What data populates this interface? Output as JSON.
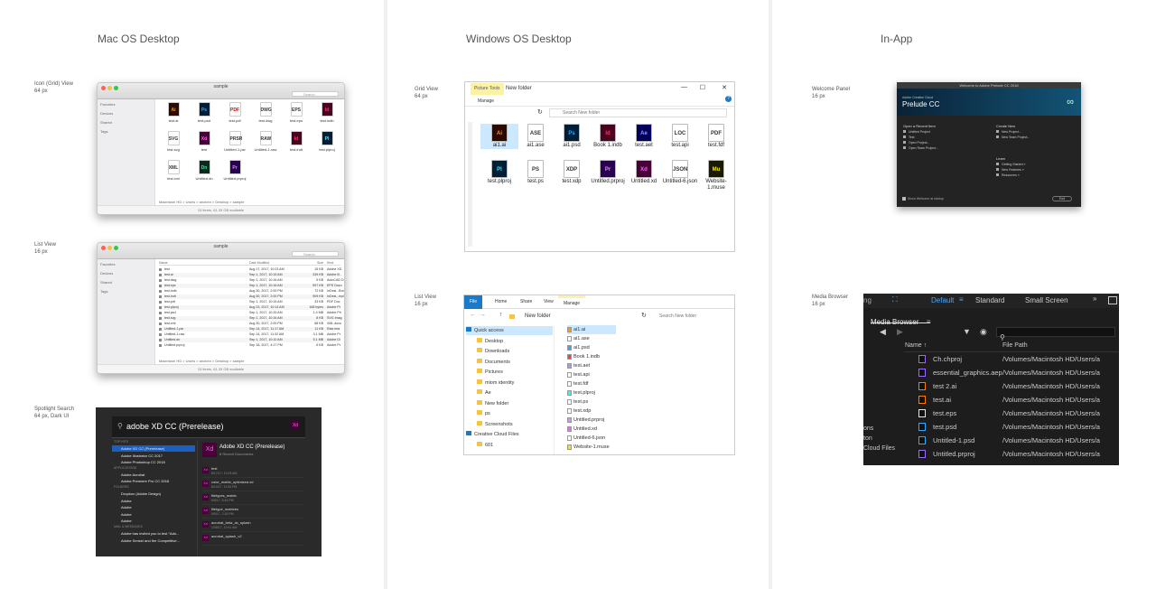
{
  "columns": {
    "mac": "Mac OS Desktop",
    "windows": "Windows OS Desktop",
    "inapp": "In-App"
  },
  "sections": {
    "mac_grid": [
      "Icon (Grid) View",
      "64 px"
    ],
    "mac_list": [
      "List View",
      "16 px"
    ],
    "mac_spot": [
      "Spotlight Search",
      "64 px, Dark UI"
    ],
    "win_grid": [
      "Grid View",
      "64 px"
    ],
    "win_list": [
      "List View",
      "16 px"
    ],
    "app_welcome": [
      "Welcome Panel",
      "16 px"
    ],
    "app_media": [
      "Media Browser",
      "16 px"
    ]
  },
  "mac_grid": {
    "title": "sample",
    "search": "Search",
    "sidebar": [
      "Favorites",
      "Devices",
      "Shared",
      "Tags"
    ],
    "path": "Macintosh HD > Users > anchen > Desktop > sample",
    "status": "15 items, 61.33 GB available",
    "files": [
      {
        "label": "test.ai",
        "glyph": "Ai",
        "color": "#2b0a00",
        "fg": "#ff9a00"
      },
      {
        "label": "test.psd",
        "glyph": "Ps",
        "color": "#001e36",
        "fg": "#31a8ff"
      },
      {
        "label": "test.pdf",
        "glyph": "PDF",
        "color": "#fff",
        "fg": "#d00"
      },
      {
        "label": "test.dwg",
        "glyph": "DWG",
        "color": "#fff",
        "fg": "#333"
      },
      {
        "label": "test.eps",
        "glyph": "EPS",
        "color": "#fff",
        "fg": "#333"
      },
      {
        "label": "test.indb",
        "glyph": "Id",
        "color": "#49021f",
        "fg": "#ff3366"
      },
      {
        "label": "test.svg",
        "glyph": "SVG",
        "color": "#fff",
        "fg": "#333"
      },
      {
        "label": "test",
        "glyph": "Xd",
        "color": "#470137",
        "fg": "#ff61f6"
      },
      {
        "label": "Untitled-1.psr",
        "glyph": "PRSR",
        "color": "#fff",
        "fg": "#333"
      },
      {
        "label": "Untitled-1.raw",
        "glyph": "RAW",
        "color": "#fff",
        "fg": "#333"
      },
      {
        "label": "test.indt",
        "glyph": "Id",
        "color": "#49021f",
        "fg": "#ff3366"
      },
      {
        "label": "test.plproj",
        "glyph": "Pl",
        "color": "#001e36",
        "fg": "#31f0ff"
      },
      {
        "label": "test.xml",
        "glyph": "XML",
        "color": "#fff",
        "fg": "#333"
      },
      {
        "label": "Untitled.dn",
        "glyph": "Dn",
        "color": "#0a2a1c",
        "fg": "#30e5b0"
      },
      {
        "label": "Untitled.prproj",
        "glyph": "Pr",
        "color": "#2a0050",
        "fg": "#d291ff"
      }
    ]
  },
  "mac_list": {
    "title": "sample",
    "search": "Search",
    "sidebar": [
      "Favorites",
      "Devices",
      "Shared",
      "Tags"
    ],
    "headers": [
      "Name",
      "Date Modified",
      "Size",
      "Kind"
    ],
    "rows": [
      [
        "test",
        "Aug 17, 2017, 10:23 AM",
        "15 KB",
        "Adobe XD"
      ],
      [
        "test.ai",
        "Sep 1, 2017, 10:15 AM",
        "339 KB",
        "Adobe Ill..."
      ],
      [
        "test.dwg",
        "Sep 1, 2017, 10:16 AM",
        "5 KB",
        "AutoCAD D"
      ],
      [
        "test.eps",
        "Sep 1, 2017, 10:16 AM",
        "597 KB",
        "EPS Docu"
      ],
      [
        "test.indb",
        "Aug 30, 2017, 2:00 PM",
        "72 KB",
        "InDesi...Book"
      ],
      [
        "test.indt",
        "Aug 30, 2017, 2:00 PM",
        "909 KB",
        "InDesi...mplate"
      ],
      [
        "test.pdf",
        "Sep 1, 2017, 10:15 AM",
        "33 KB",
        "PDF Doc"
      ],
      [
        "test.plproj",
        "Aug 23, 2017, 10:14 AM",
        "168 bytes",
        "Adobe Pr"
      ],
      [
        "test.psd",
        "Sep 1, 2017, 10:15 AM",
        "1.4 MB",
        "Adobe Ph"
      ],
      [
        "test.svg",
        "Sep 1, 2017, 10:16 AM",
        "8 KB",
        "SVG Imag"
      ],
      [
        "test.xml",
        "Aug 30, 2017, 2:00 PM",
        "68 KB",
        "XML docu"
      ],
      [
        "Untitled-1.psr",
        "Sep 14, 2017, 11:17 AM",
        "11 KB",
        "Raw ima"
      ],
      [
        "Untitled-1.raw",
        "Sep 14, 2017, 11:32 AM",
        "3.1 MB",
        "Adobe Pr"
      ],
      [
        "Untitled.dn",
        "Sep 1, 2017, 10:10 AM",
        "5.1 MB",
        "Adobe Di"
      ],
      [
        "Untitled.prproj",
        "Sep 18, 2017, 4:17 PM",
        "6 KB",
        "Adobe Pr"
      ]
    ],
    "path": "Macintosh HD > Users > anchen > Desktop > sample",
    "status": "15 items, 61.33 GB available"
  },
  "spotlight": {
    "query": "adobe XD CC (Prerelease)",
    "hero_title": "Adobe XD CC (Prerelease)",
    "hero_sub": "8 Recent Documents",
    "left": [
      {
        "type": "h",
        "t": "TOP HITS"
      },
      {
        "type": "sel",
        "t": "Adobe XD CC (Prerelease)"
      },
      {
        "type": "i",
        "t": "Adobe Illustrator CC 2017"
      },
      {
        "type": "i",
        "t": "Adobe Photoshop CC 2018"
      },
      {
        "type": "h",
        "t": "APPLICATIONS"
      },
      {
        "type": "i",
        "t": "Adobe Acrobat"
      },
      {
        "type": "i",
        "t": "Adobe Premiere Pro CC 2018"
      },
      {
        "type": "h",
        "t": "FOLDERS"
      },
      {
        "type": "i",
        "t": "Dropbox (Adobe Design)"
      },
      {
        "type": "i",
        "t": "Adobe"
      },
      {
        "type": "i",
        "t": "Adobe"
      },
      {
        "type": "i",
        "t": "Adobe"
      },
      {
        "type": "i",
        "t": "Adobe"
      },
      {
        "type": "h",
        "t": "MAIL & MESSAGES"
      },
      {
        "type": "i",
        "t": "Adobe has invited you to test \"Ado..."
      },
      {
        "type": "i",
        "t": "Adobe Sensei and the Competitive..."
      }
    ],
    "docs": [
      {
        "name": "test",
        "date": "8/17/17, 10:23 AM"
      },
      {
        "name": "color_matrix_optimized.xd",
        "date": "8/10/17, 11:54 PM"
      },
      {
        "name": "filetypes_matrix",
        "date": "5/5/17, 6:16 PM"
      },
      {
        "name": "filetype_matrixes",
        "date": "5/5/17, 2:18 PM"
      },
      {
        "name": "acrobat_beta_dc_splash",
        "date": "10/8/17, 10:41 AM"
      },
      {
        "name": "acrobat_splash_v2",
        "date": ""
      }
    ]
  },
  "win_grid": {
    "context_tab": "Picture Tools",
    "folder": "New folder",
    "ribbon_tab": "Manage",
    "search": "Search New folder",
    "files": [
      {
        "label": "ai1.ai",
        "glyph": "Ai",
        "color": "#2b0a00",
        "fg": "#ff9a00",
        "sel": true
      },
      {
        "label": "ai1.ase",
        "glyph": "ASE",
        "color": "#fff",
        "fg": "#333"
      },
      {
        "label": "ai1.psd",
        "glyph": "Ps",
        "color": "#001e36",
        "fg": "#31a8ff"
      },
      {
        "label": "Book 1.indb",
        "glyph": "Id",
        "color": "#49021f",
        "fg": "#ff3366"
      },
      {
        "label": "test.aet",
        "glyph": "Ae",
        "color": "#00005b",
        "fg": "#9999ff"
      },
      {
        "label": "test.api",
        "glyph": "LOC",
        "color": "#fff",
        "fg": "#333"
      },
      {
        "label": "test.fdf",
        "glyph": "PDF",
        "color": "#fff",
        "fg": "#333"
      },
      {
        "label": "test.plproj",
        "glyph": "Pl",
        "color": "#001e36",
        "fg": "#31f0ff"
      },
      {
        "label": "test.ps",
        "glyph": "PS",
        "color": "#fff",
        "fg": "#333"
      },
      {
        "label": "test.xdp",
        "glyph": "XDP",
        "color": "#fff",
        "fg": "#333"
      },
      {
        "label": "Untitled.prproj",
        "glyph": "Pr",
        "color": "#2a0050",
        "fg": "#d291ff"
      },
      {
        "label": "Untitled.xd",
        "glyph": "Xd",
        "color": "#470137",
        "fg": "#ff61f6"
      },
      {
        "label": "Untitled-6.json",
        "glyph": "JSON",
        "color": "#fff",
        "fg": "#333"
      },
      {
        "label": "Website-1.muse",
        "glyph": "Mu",
        "color": "#1a1a00",
        "fg": "#f7e600"
      }
    ]
  },
  "win_list": {
    "tabs": [
      "File",
      "Home",
      "Share",
      "View",
      "Manage"
    ],
    "folder": "New folder",
    "search": "Search New folder",
    "tree": [
      "Quick access",
      "Desktop",
      "Downloads",
      "Documents",
      "Pictures",
      "miom identity",
      "Ae",
      "New folder",
      "ps",
      "Screenshots",
      "Creative Cloud Files",
      "601"
    ],
    "files": [
      {
        "label": "ai1.ai",
        "color": "#ff9a00",
        "sel": true
      },
      {
        "label": "ai1.ase",
        "color": "#fff"
      },
      {
        "label": "ai1.psd",
        "color": "#31a8ff"
      },
      {
        "label": "Book 1.indb",
        "color": "#ff3366"
      },
      {
        "label": "test.aet",
        "color": "#9999ff"
      },
      {
        "label": "test.api",
        "color": "#fff"
      },
      {
        "label": "test.fdf",
        "color": "#fff"
      },
      {
        "label": "test.plproj",
        "color": "#31f0ff"
      },
      {
        "label": "test.ps",
        "color": "#fff"
      },
      {
        "label": "test.xdp",
        "color": "#fff"
      },
      {
        "label": "Untitled.prproj",
        "color": "#d291ff"
      },
      {
        "label": "Untitled.xd",
        "color": "#ff61f6"
      },
      {
        "label": "Untitled-6.json",
        "color": "#fff"
      },
      {
        "label": "Website-1.muse",
        "color": "#f7e600"
      }
    ]
  },
  "welcome": {
    "window_title": "Welcome to Adobe Prelude CC 2018",
    "brand_small": "Adobe Creative Cloud",
    "brand": "Prelude CC",
    "open_title": "Open a Recent Item",
    "recent": [
      "Untitled Project",
      "Test",
      "Open Project...",
      "Open Team Project..."
    ],
    "create_title": "Create New",
    "create": [
      "New Project...",
      "New Team Project..."
    ],
    "learn_title": "Learn",
    "learn": [
      "Getting Started »",
      "New Features »",
      "Resources »"
    ],
    "checkbox": "Show Welcome at startup",
    "exit": "Exit"
  },
  "media": {
    "workspaces": [
      "ng",
      "Default",
      "Standard",
      "Small Screen"
    ],
    "panel": "Media Browser",
    "col_name": "Name",
    "col_path": "File Path",
    "left_stub": [
      "ons",
      "ton",
      "Cloud Files"
    ],
    "files": [
      {
        "name": "Ch.chproj",
        "path": "/Volumes/Macintosh HD/Users/a",
        "color": "#9a6bff"
      },
      {
        "name": "essential_graphics.aep",
        "path": "/Volumes/Macintosh HD/Users/a",
        "color": "#9a6bff"
      },
      {
        "name": "test 2.ai",
        "path": "/Volumes/Macintosh HD/Users/a",
        "color": "#ff7c00"
      },
      {
        "name": "test.ai",
        "path": "/Volumes/Macintosh HD/Users/a",
        "color": "#ff7c00"
      },
      {
        "name": "test.eps",
        "path": "/Volumes/Macintosh HD/Users/a",
        "color": "#e6e6e6"
      },
      {
        "name": "test.psd",
        "path": "/Volumes/Macintosh HD/Users/a",
        "color": "#31a8ff"
      },
      {
        "name": "Untitled-1.psd",
        "path": "/Volumes/Macintosh HD/Users/a",
        "color": "#31a8ff"
      },
      {
        "name": "Untitled.prproj",
        "path": "/Volumes/Macintosh HD/Users/a",
        "color": "#9a6bff"
      }
    ]
  }
}
